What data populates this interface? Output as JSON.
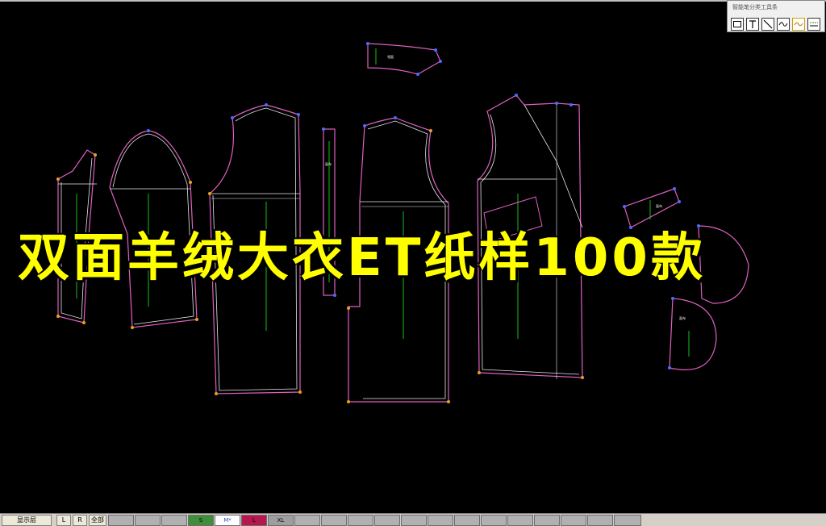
{
  "overlay": {
    "title": "双面羊绒大衣ET纸样100款"
  },
  "toolbox": {
    "title": "智能笔分类工具条",
    "tools": [
      {
        "icon": "rectangle-icon"
      },
      {
        "icon": "text-tool-icon"
      },
      {
        "icon": "line-tool-icon"
      },
      {
        "icon": "curve-tool-icon"
      },
      {
        "icon": "smooth-curve-icon"
      },
      {
        "icon": "dash-line-icon"
      }
    ]
  },
  "statusbar": {
    "display_layer": "显示层",
    "btn_l": "L",
    "btn_r": "R",
    "btn_all": "全部",
    "sizes": [
      "S",
      "M*",
      "L",
      "XL"
    ],
    "size_colors": {
      "S": "#3f8f3a",
      "M*": "#ffffff",
      "L": "#b5174e",
      "XL": "#9e9e9e"
    }
  },
  "colors": {
    "background": "#000000",
    "outline_pink": "#e060c0",
    "outline_white": "#e8e8e8",
    "grain_green": "#18c018",
    "point_blue": "#4d6bff",
    "point_orange": "#e8a020",
    "overlay_yellow": "#ffff00"
  }
}
